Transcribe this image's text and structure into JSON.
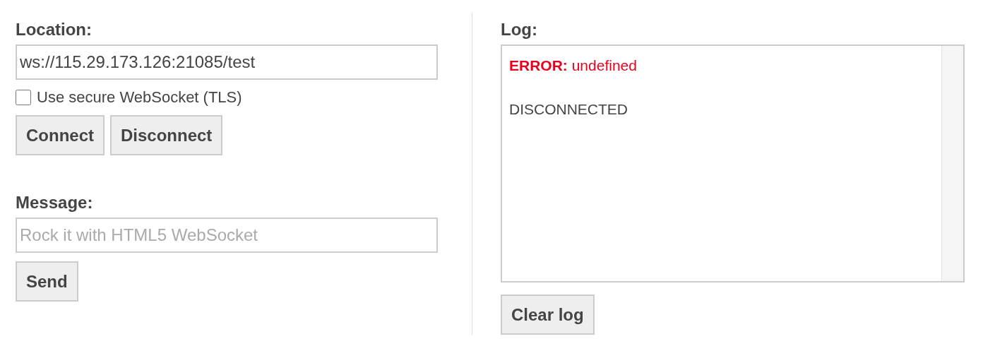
{
  "connection": {
    "label": "Location:",
    "value": "ws://115.29.173.126:21085/test",
    "secure": {
      "label": "Use secure WebSocket (TLS)",
      "checked": false
    },
    "buttons": [
      "Connect",
      "Disconnect"
    ]
  },
  "message": {
    "label": "Message:",
    "placeholder": "Rock it with HTML5 WebSocket",
    "button": "Send"
  },
  "log": {
    "label": "Log:",
    "entries": [
      {
        "kind": "error",
        "text": "**ERROR:** undefined"
      },
      {
        "kind": "info",
        "text": "DISCONNECTED"
      }
    ],
    "button": "Clear log"
  }
}
